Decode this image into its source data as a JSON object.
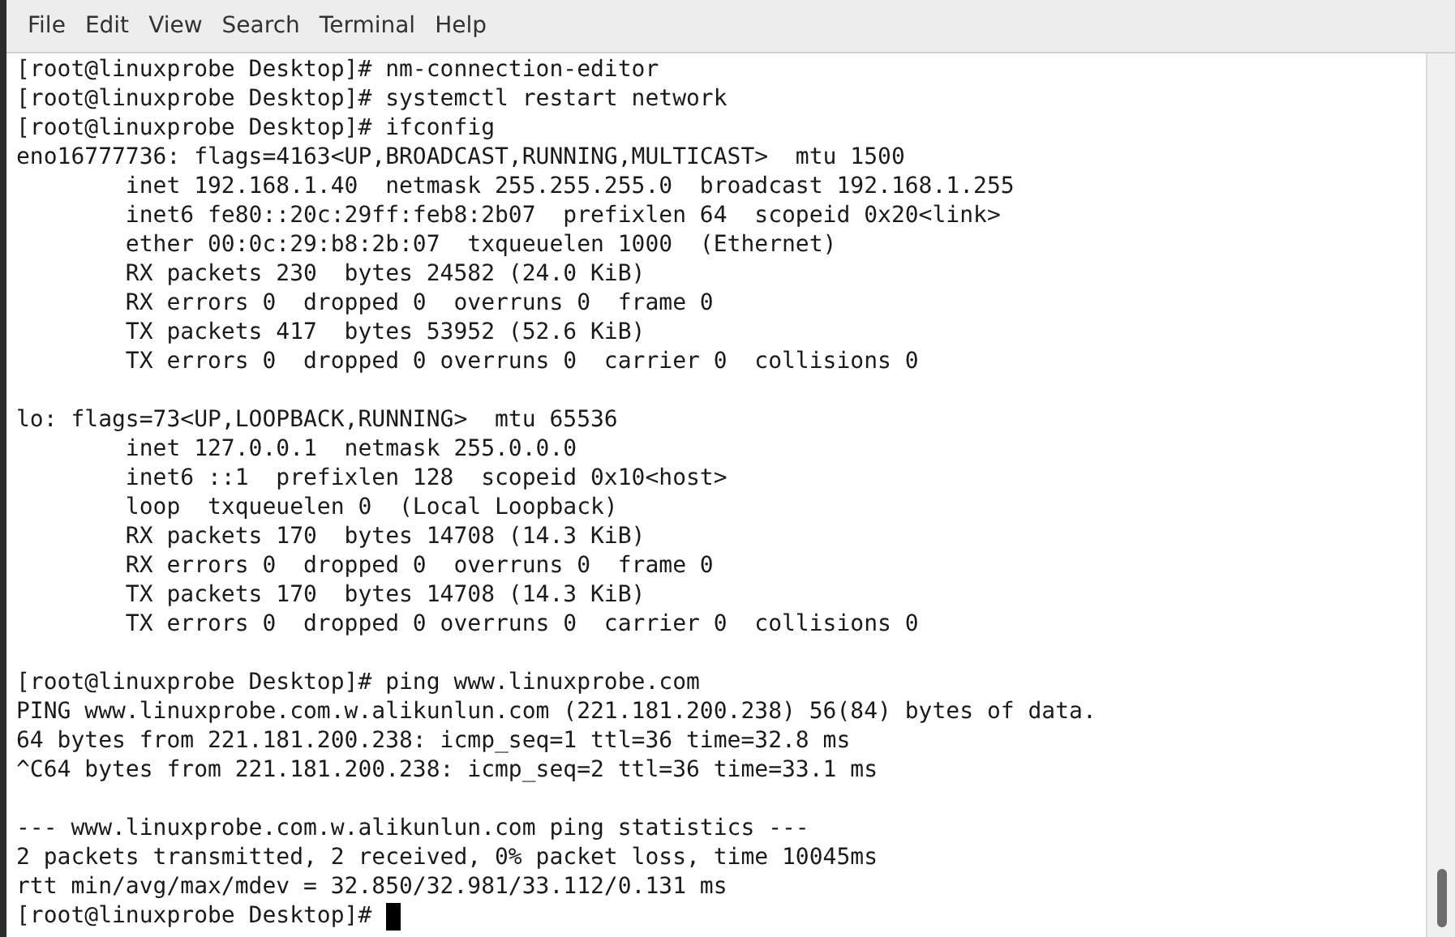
{
  "menu_bar": [
    "File",
    "Edit",
    "View",
    "Search",
    "Terminal",
    "Help"
  ],
  "terminal": {
    "cursor_visible": true,
    "blocks": [
      [
        "[root@linuxprobe Desktop]# nm-connection-editor",
        "[root@linuxprobe Desktop]# systemctl restart network",
        "[root@linuxprobe Desktop]# ifconfig",
        "eno16777736: flags=4163<UP,BROADCAST,RUNNING,MULTICAST>  mtu 1500",
        "        inet 192.168.1.40  netmask 255.255.255.0  broadcast 192.168.1.255",
        "        inet6 fe80::20c:29ff:feb8:2b07  prefixlen 64  scopeid 0x20<link>",
        "        ether 00:0c:29:b8:2b:07  txqueuelen 1000  (Ethernet)",
        "        RX packets 230  bytes 24582 (24.0 KiB)",
        "        RX errors 0  dropped 0  overruns 0  frame 0",
        "        TX packets 417  bytes 53952 (52.6 KiB)",
        "        TX errors 0  dropped 0 overruns 0  carrier 0  collisions 0"
      ],
      [
        "lo: flags=73<UP,LOOPBACK,RUNNING>  mtu 65536",
        "        inet 127.0.0.1  netmask 255.0.0.0",
        "        inet6 ::1  prefixlen 128  scopeid 0x10<host>",
        "        loop  txqueuelen 0  (Local Loopback)",
        "        RX packets 170  bytes 14708 (14.3 KiB)",
        "        RX errors 0  dropped 0  overruns 0  frame 0",
        "        TX packets 170  bytes 14708 (14.3 KiB)",
        "        TX errors 0  dropped 0 overruns 0  carrier 0  collisions 0"
      ],
      [
        "[root@linuxprobe Desktop]# ping www.linuxprobe.com",
        "PING www.linuxprobe.com.w.alikunlun.com (221.181.200.238) 56(84) bytes of data.",
        "64 bytes from 221.181.200.238: icmp_seq=1 ttl=36 time=32.8 ms",
        "^C64 bytes from 221.181.200.238: icmp_seq=2 ttl=36 time=33.1 ms"
      ],
      [
        "--- www.linuxprobe.com.w.alikunlun.com ping statistics ---",
        "2 packets transmitted, 2 received, 0% packet loss, time 10045ms",
        "rtt min/avg/max/mdev = 32.850/32.981/33.112/0.131 ms",
        "[root@linuxprobe Desktop]# "
      ]
    ]
  }
}
